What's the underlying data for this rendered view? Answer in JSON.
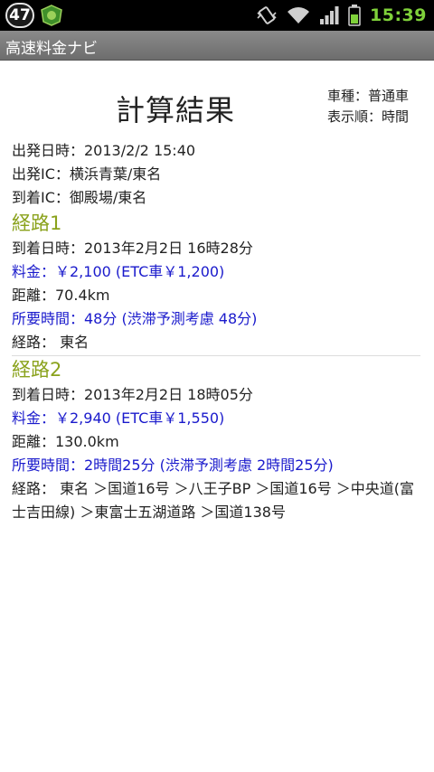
{
  "status_bar": {
    "notification_count": "47",
    "time": "15:39",
    "colors": {
      "clock": "#7fd13a",
      "battery": "#7fd13a"
    }
  },
  "app": {
    "title": "高速料金ナビ"
  },
  "result": {
    "title": "計算結果",
    "vehicle_type": "車種：普通車",
    "sort_order": "表示順：時間",
    "departure_datetime": "出発日時：2013/2/2 15:40",
    "departure_ic": "出発IC：横浜青葉/東名",
    "arrival_ic": "到着IC：御殿場/東名",
    "routes": [
      {
        "heading": "経路1",
        "arrival": "到着日時：2013年2月2日 16時28分",
        "fare": "料金：￥2,100 (ETC車￥1,200)",
        "distance": "距離：70.4km",
        "duration": "所要時間：48分 (渋滞予測考慮 48分)",
        "path": "経路： 東名"
      },
      {
        "heading": "経路2",
        "arrival": "到着日時：2013年2月2日 18時05分",
        "fare": "料金：￥2,940 (ETC車￥1,550)",
        "distance": "距離：130.0km",
        "duration": "所要時間：2時間25分 (渋滞予測考慮 2時間25分)",
        "path": "経路： 東名 ＞国道16号 ＞八王子BP ＞国道16号 ＞中央道(富士吉田線) ＞東富士五湖道路 ＞国道138号"
      }
    ],
    "colors": {
      "heading": "#8aa21c",
      "highlight": "#1a1acc"
    }
  }
}
